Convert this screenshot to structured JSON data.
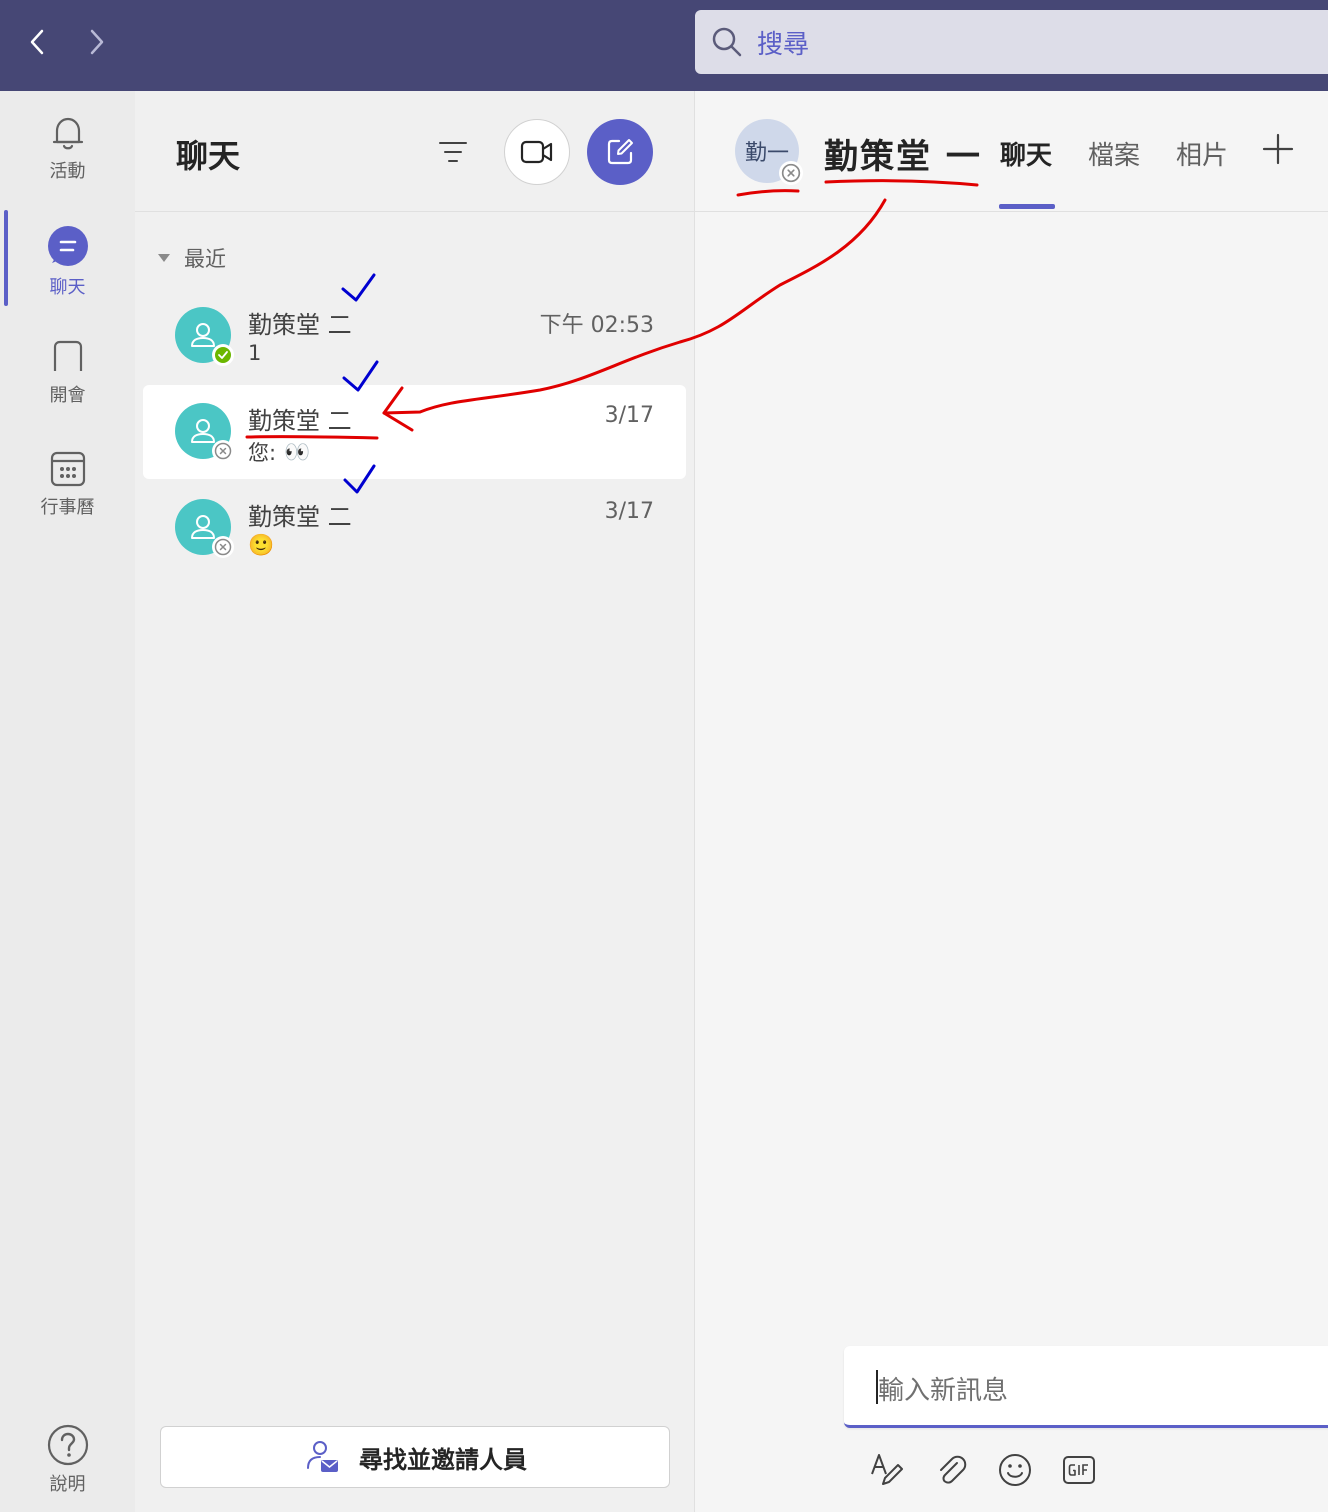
{
  "search": {
    "placeholder": "搜尋"
  },
  "rail": {
    "items": [
      {
        "label": "活動",
        "icon": "bell-icon"
      },
      {
        "label": "聊天",
        "icon": "chat-icon",
        "active": true
      },
      {
        "label": "開會",
        "icon": "meeting-icon"
      },
      {
        "label": "行事曆",
        "icon": "calendar-icon"
      },
      {
        "label": "說明",
        "icon": "help-icon"
      }
    ]
  },
  "chat_list": {
    "title": "聊天",
    "section": "最近",
    "items": [
      {
        "name": "勤策堂 二",
        "preview": "1",
        "time": "下午 02:53",
        "presence": "available"
      },
      {
        "name": "勤策堂 二",
        "preview_prefix": "您:",
        "preview_emoji": "👀",
        "time": "3/17",
        "presence": "offline",
        "selected": true
      },
      {
        "name": "勤策堂 二",
        "preview_emoji": "🙂",
        "time": "3/17",
        "presence": "offline"
      }
    ],
    "invite_label": "尋找並邀請人員"
  },
  "conversation": {
    "avatar_initials": "勤一",
    "name": "勤策堂 一",
    "tabs": [
      "聊天",
      "檔案",
      "相片"
    ],
    "active_tab": "聊天",
    "composer_placeholder": "輸入新訊息"
  },
  "colors": {
    "titlebar": "#464775",
    "accent": "#5b5fc7",
    "avatar_teal": "#4bc6c5",
    "annotation_red": "#e00000",
    "annotation_blue": "#0000d0"
  }
}
